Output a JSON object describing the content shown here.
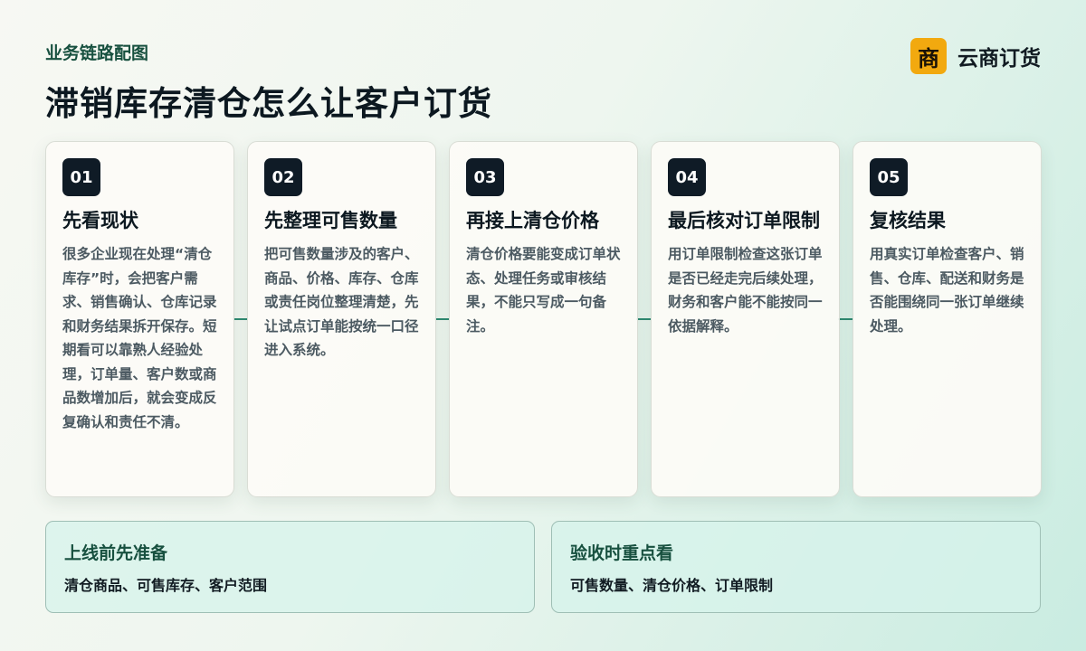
{
  "header": {
    "kicker": "业务链路配图",
    "title": "滞销库存清仓怎么让客户订货"
  },
  "brand": {
    "icon_char": "商",
    "name": "云商订货",
    "accent_color": "#f2a90f"
  },
  "steps": [
    {
      "number": "01",
      "title": "先看现状",
      "body": "很多企业现在处理“清仓库存”时，会把客户需求、销售确认、仓库记录和财务结果拆开保存。短期看可以靠熟人经验处理，订单量、客户数或商品数增加后，就会变成反复确认和责任不清。"
    },
    {
      "number": "02",
      "title": "先整理可售数量",
      "body": "把可售数量涉及的客户、商品、价格、库存、仓库或责任岗位整理清楚，先让试点订单能按统一口径进入系统。"
    },
    {
      "number": "03",
      "title": "再接上清仓价格",
      "body": "清仓价格要能变成订单状态、处理任务或审核结果，不能只写成一句备注。"
    },
    {
      "number": "04",
      "title": "最后核对订单限制",
      "body": "用订单限制检查这张订单是否已经走完后续处理，财务和客户能不能按同一依据解释。"
    },
    {
      "number": "05",
      "title": "复核结果",
      "body": "用真实订单检查客户、销售、仓库、配送和财务是否能围绕同一张订单继续处理。"
    }
  ],
  "panels": {
    "prepare": {
      "title": "上线前先准备",
      "text": "清仓商品、可售库存、客户范围"
    },
    "acceptance": {
      "title": "验收时重点看",
      "text": "可售数量、清仓价格、订单限制"
    }
  },
  "colors": {
    "badge_bg": "#0f1b26",
    "connector": "#2f8a72",
    "kicker": "#17503f"
  }
}
